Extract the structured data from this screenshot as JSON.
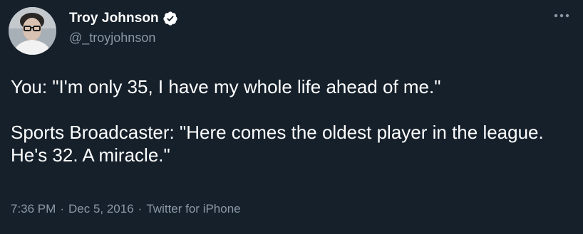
{
  "tweet": {
    "author": {
      "display_name": "Troy Johnson",
      "handle": "@_troyjohnson",
      "verified": true,
      "avatar_icon": "avatar-photo"
    },
    "more_icon": "more-options-icon",
    "text_lines": [
      "You: \"I'm only 35, I have my whole life ahead of me.\"",
      "Sports Broadcaster: \"Here comes the oldest player in the league. He's 32. A miracle.\""
    ],
    "time": "7:36 PM",
    "separator": "·",
    "date": "Dec 5, 2016",
    "source": "Twitter for iPhone"
  },
  "colors": {
    "background": "#15202b",
    "primary_text": "#ffffff",
    "secondary_text": "#8b98a5",
    "verified_badge": "#ffffff"
  }
}
